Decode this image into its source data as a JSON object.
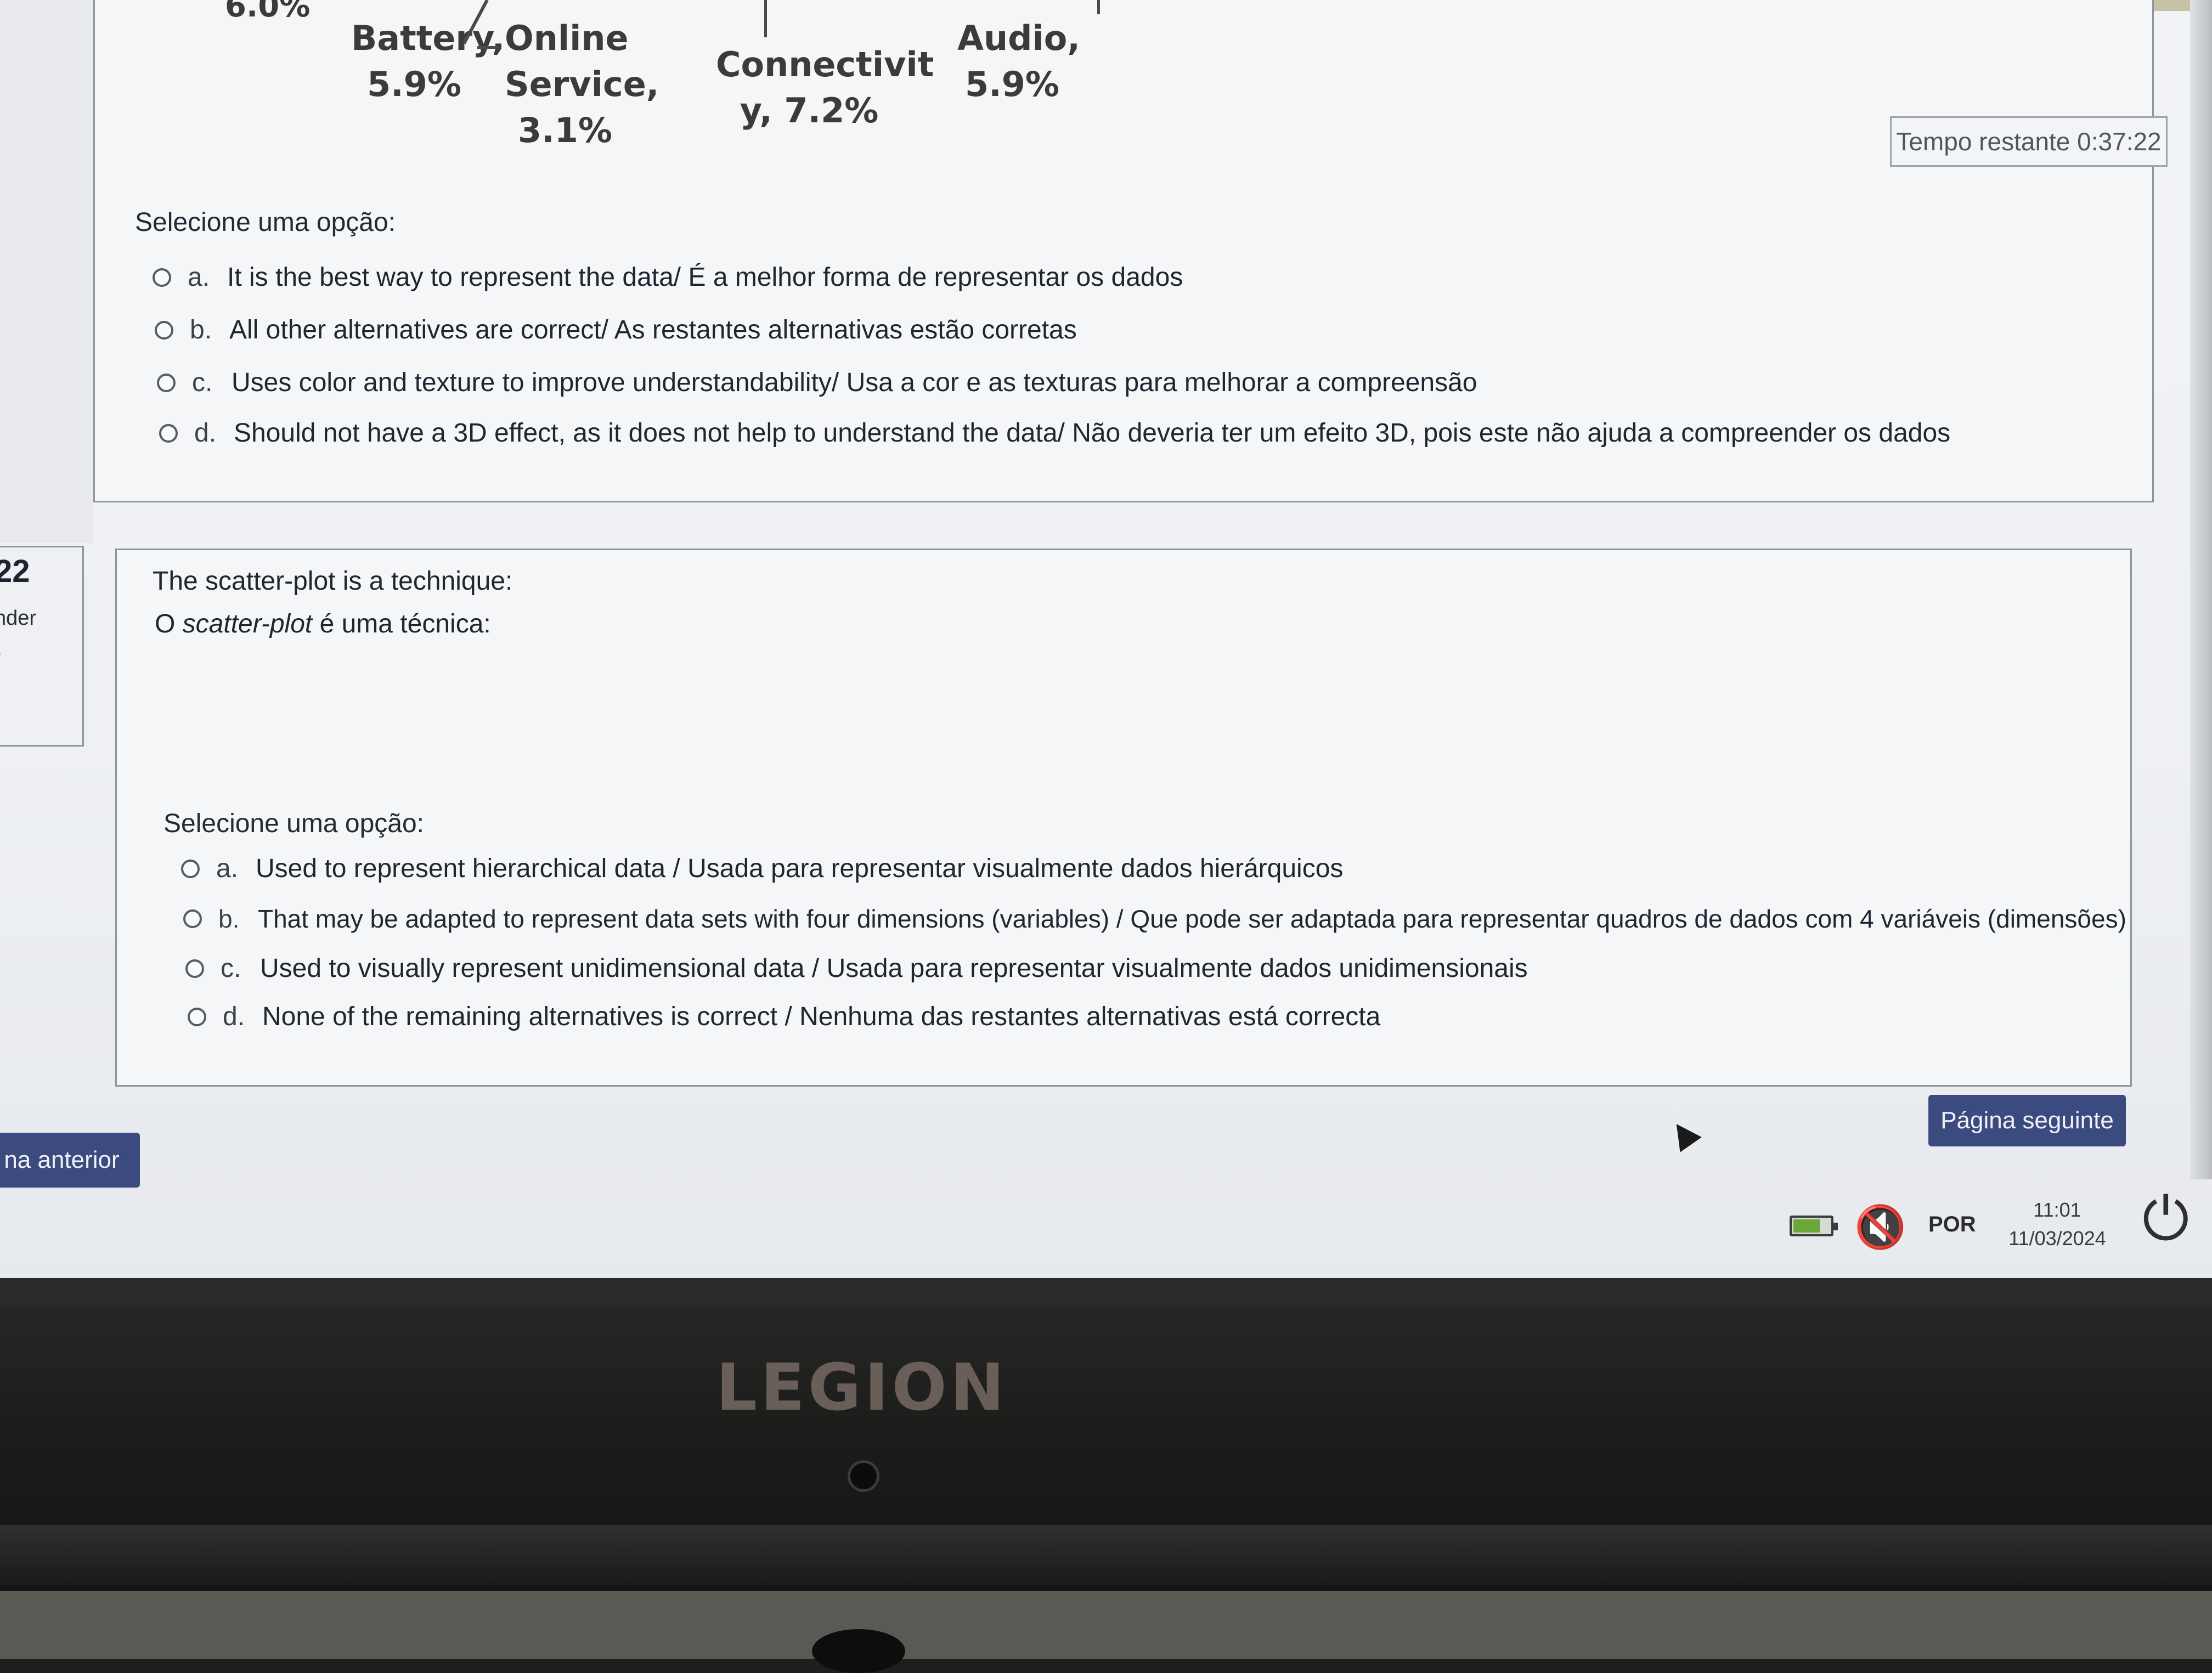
{
  "chart_fragment": {
    "labels": [
      {
        "text": "6.0%"
      },
      {
        "text": "Battery,\n5.9%"
      },
      {
        "text": "Online\nService,\n3.1%"
      },
      {
        "text": "Connectivit\ny, 7.2%"
      },
      {
        "text": "Audio,\n5.9%"
      }
    ]
  },
  "timer": "Tempo restante 0:37:22",
  "question1": {
    "prompt": "Selecione uma opção:",
    "options": [
      {
        "letter": "a.",
        "text": "It is the best way to represent the data/ É a melhor forma de representar os dados"
      },
      {
        "letter": "b.",
        "text": "All other alternatives are correct/ As restantes alternativas estão corretas"
      },
      {
        "letter": "c.",
        "text": "Uses color and texture to improve understandability/ Usa a cor e as texturas para melhorar a compreensão"
      },
      {
        "letter": "d.",
        "text": "Should not have a 3D effect, as it does not help to understand the data/ Não deveria ter um efeito 3D, pois este não ajuda a compreender os dados"
      }
    ]
  },
  "question2_info": {
    "number": "22",
    "status": "nder",
    "extra": ")"
  },
  "question2": {
    "text_en": "The scatter-plot is a technique:",
    "text_pt_prefix": "O ",
    "text_pt_italic": "scatter-plot",
    "text_pt_suffix": " é uma técnica:",
    "prompt": "Selecione uma opção:",
    "options": [
      {
        "letter": "a.",
        "text": "Used to represent hierarchical data / Usada para representar visualmente dados hierárquicos"
      },
      {
        "letter": "b.",
        "text": "That may be adapted to represent data sets with four dimensions (variables) / Que pode ser adaptada para representar quadros de dados com 4 variáveis (dimensões)"
      },
      {
        "letter": "c.",
        "text": "Used to visually represent unidimensional data / Usada para representar visualmente dados unidimensionais"
      },
      {
        "letter": "d.",
        "text": "None of the remaining alternatives is correct / Nenhuma das restantes alternativas está correcta"
      }
    ]
  },
  "nav": {
    "prev_label": "na anterior",
    "next_label": "Página seguinte"
  },
  "taskbar": {
    "battery_icon": "battery-icon",
    "speaker_icon": "speaker-muted-icon",
    "language": "POR",
    "time": "11:01",
    "date": "11/03/2024",
    "power_icon": "power-icon"
  },
  "device": {
    "brand": "LEGION"
  }
}
